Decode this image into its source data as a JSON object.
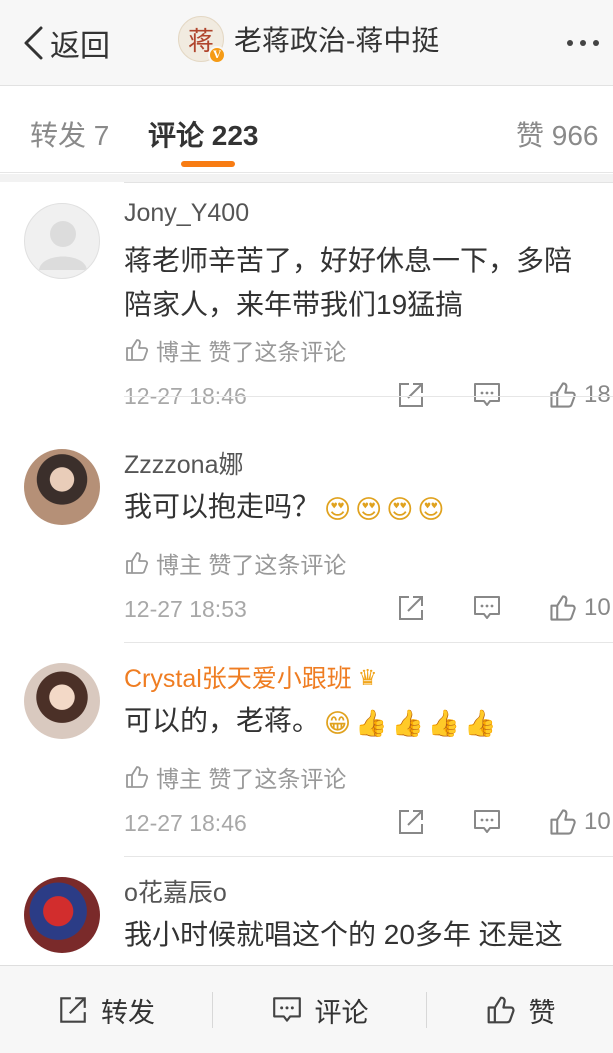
{
  "nav": {
    "back_label": "返回",
    "title": "老蒋政治-蒋中挺",
    "avatar_glyph": "蒋"
  },
  "tabs": [
    {
      "label": "转发 7"
    },
    {
      "label": "评论 223"
    },
    {
      "label": "赞 966"
    }
  ],
  "comments": [
    {
      "user": "Jony_Y400",
      "lines": [
        "蒋老师辛苦了，好好休息一下，多陪",
        "陪家人，来年带我们19猛搞"
      ],
      "liked_by": "博主 赞了这条评论",
      "time": "12-27 18:46",
      "like_count": "18"
    },
    {
      "user": "Zzzzona娜",
      "text": "我可以抱走吗？",
      "emojis": [
        "😍",
        "😍",
        "😍",
        "😍"
      ],
      "liked_by": "博主 赞了这条评论",
      "time": "12-27 18:53",
      "like_count": "10"
    },
    {
      "user": "Crystal张天爱小跟班",
      "text": "可以的，老蒋。",
      "emojis": [
        "😁",
        "👍",
        "👍",
        "👍",
        "👍"
      ],
      "liked_by": "博主 赞了这条评论",
      "time": "12-27 18:46",
      "like_count": "10"
    },
    {
      "user": "o花嘉辰o",
      "text": "我小时候就唱这个的 20多年 还是这"
    }
  ],
  "bottom": {
    "repost": "转发",
    "comment": "评论",
    "like": "赞"
  },
  "colors": {
    "accent": "#f87c13",
    "vip_name": "#ef7d22",
    "secondary_text": "#999999"
  }
}
